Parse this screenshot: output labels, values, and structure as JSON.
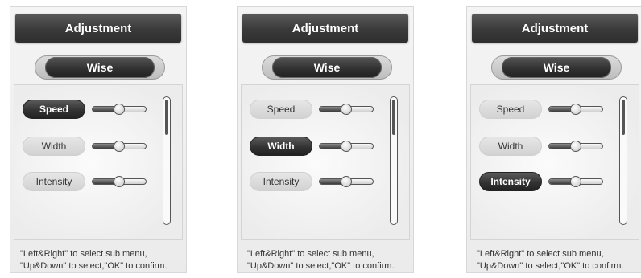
{
  "panels": [
    {
      "title": "Adjustment",
      "mode": "Wise",
      "active_index": 0,
      "items": [
        {
          "label": "Speed",
          "level": 0.5
        },
        {
          "label": "Width",
          "level": 0.5
        },
        {
          "label": "Intensity",
          "level": 0.5
        }
      ],
      "hint_line1": "\"Left&Right\" to select sub menu,",
      "hint_line2": "\"Up&Down\" to select,\"OK\" to confirm."
    },
    {
      "title": "Adjustment",
      "mode": "Wise",
      "active_index": 1,
      "items": [
        {
          "label": "Speed",
          "level": 0.5
        },
        {
          "label": "Width",
          "level": 0.5
        },
        {
          "label": "Intensity",
          "level": 0.5
        }
      ],
      "hint_line1": "\"Left&Right\" to select sub menu,",
      "hint_line2": "\"Up&Down\" to select,\"OK\" to confirm."
    },
    {
      "title": "Adjustment",
      "mode": "Wise",
      "active_index": 2,
      "items": [
        {
          "label": "Speed",
          "level": 0.5
        },
        {
          "label": "Width",
          "level": 0.5
        },
        {
          "label": "Intensity",
          "level": 0.5
        }
      ],
      "hint_line1": "\"Left&Right\" to select sub menu,",
      "hint_line2": "\"Up&Down\" to select,\"OK\" to confirm."
    }
  ]
}
